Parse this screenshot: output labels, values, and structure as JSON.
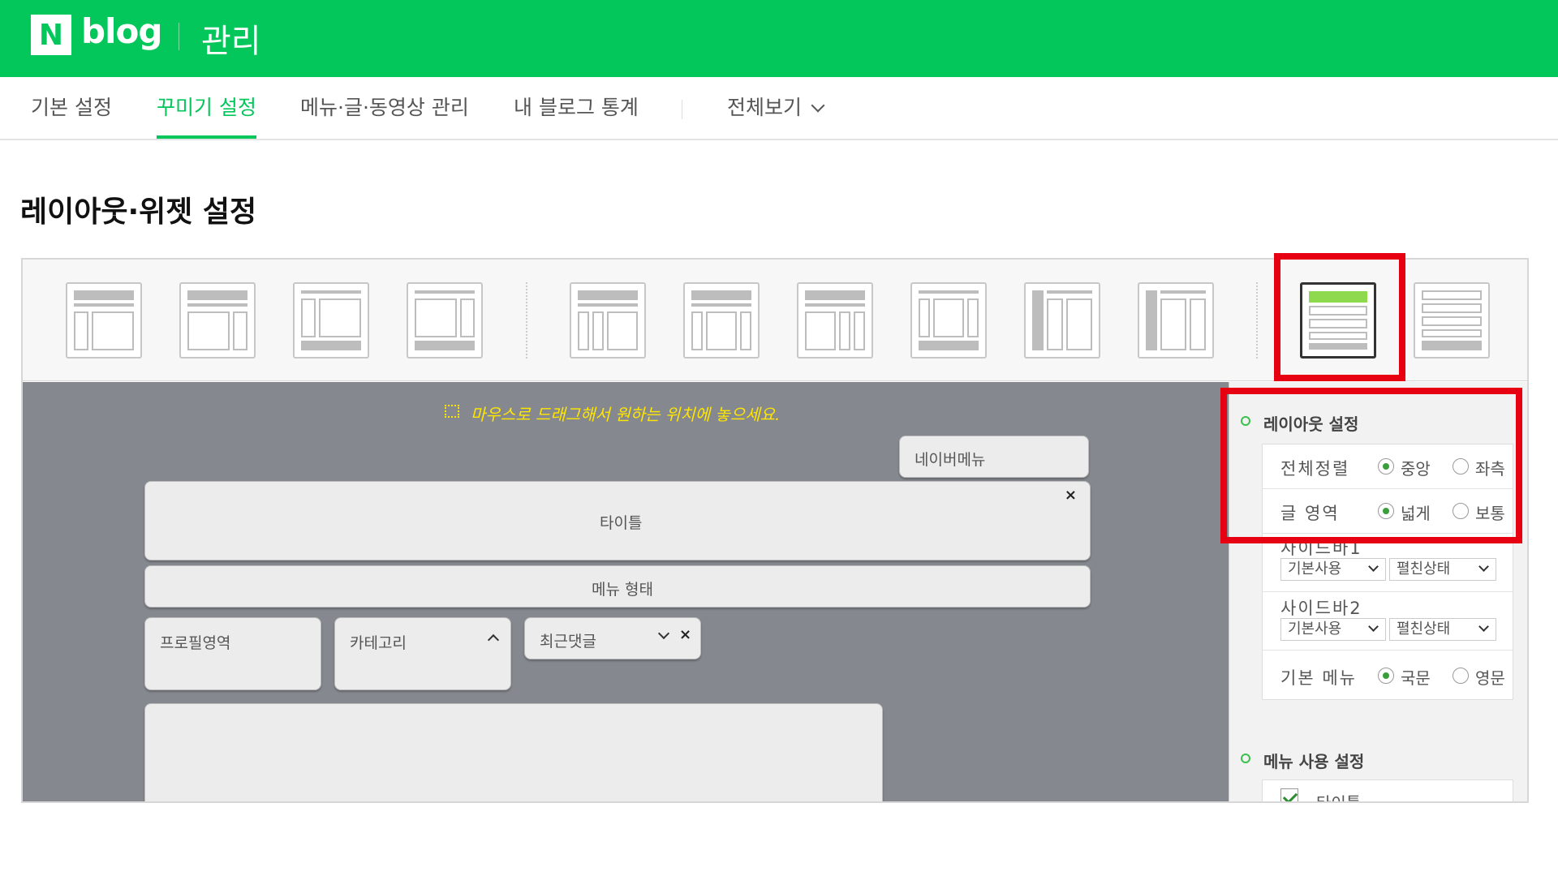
{
  "header": {
    "logo_mark": "N",
    "logo_text": "blog",
    "section": "관리"
  },
  "tabs": [
    {
      "label": "기본 설정",
      "active": false
    },
    {
      "label": "꾸미기 설정",
      "active": true
    },
    {
      "label": "메뉴·글·동영상 관리",
      "active": false
    },
    {
      "label": "내 블로그 통계",
      "active": false
    },
    {
      "label": "전체보기",
      "active": false
    }
  ],
  "page_title": "레이아웃·위젯 설정",
  "workspace": {
    "hint": "마우스로 드래그해서 원하는 위치에 놓으세요.",
    "widgets": {
      "naver_menu": "네이버메뉴",
      "title": "타이틀",
      "menu_type": "메뉴 형태",
      "profile": "프로필영역",
      "category": "카테고리",
      "recent_comments": "최근댓글"
    },
    "close_glyph": "×"
  },
  "panel": {
    "layout_settings": {
      "title": "레이아웃 설정",
      "rows": [
        {
          "label": "전체정렬",
          "options": [
            "중앙",
            "좌측"
          ],
          "selected": "중앙"
        },
        {
          "label": "글 영역",
          "options": [
            "넓게",
            "보통"
          ],
          "selected": "넓게"
        }
      ],
      "sidebar1": {
        "label": "사이드바1",
        "select1": "기본사용",
        "select2": "펼친상태"
      },
      "sidebar2": {
        "label": "사이드바2",
        "select1": "기본사용",
        "select2": "펼친상태"
      },
      "basic_menu": {
        "label": "기본 메뉴",
        "options": [
          "국문",
          "영문"
        ],
        "selected": "국문"
      }
    },
    "menu_settings": {
      "title": "메뉴 사용 설정",
      "first_item": "타이틀",
      "first_checked": true
    }
  },
  "colors": {
    "brand_green": "#03c75a",
    "workspace_gray": "#85888e",
    "hint_yellow": "#ffe600",
    "highlight_red": "#e60012"
  }
}
